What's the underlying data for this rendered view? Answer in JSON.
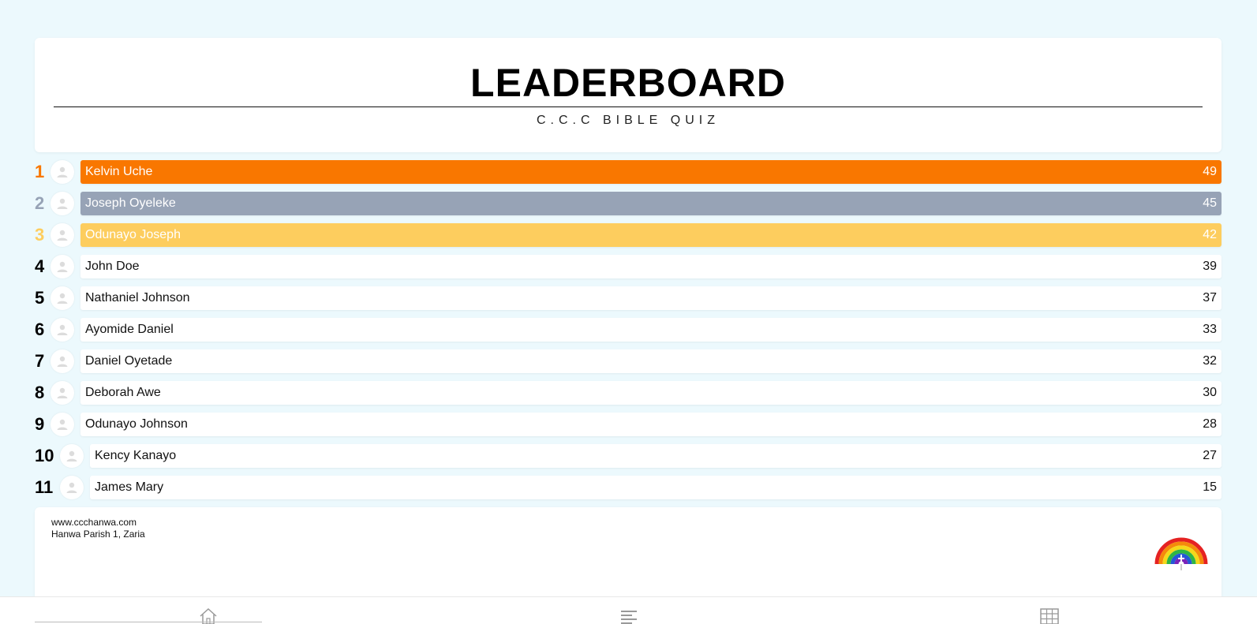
{
  "header": {
    "title": "LEADERBOARD",
    "subtitle": "C.C.C BIBLE QUIZ"
  },
  "colors": {
    "first": "#f97700",
    "second": "#97a3b6",
    "third": "#fdcd5e",
    "default_bar": "#ffffff",
    "page_background": "#ecf9fd"
  },
  "leaderboard": [
    {
      "rank": "1",
      "name": "Kelvin Uche",
      "score": "49"
    },
    {
      "rank": "2",
      "name": "Joseph Oyeleke",
      "score": "45"
    },
    {
      "rank": "3",
      "name": "Odunayo Joseph",
      "score": "42"
    },
    {
      "rank": "4",
      "name": "John Doe",
      "score": "39"
    },
    {
      "rank": "5",
      "name": "Nathaniel Johnson",
      "score": "37"
    },
    {
      "rank": "6",
      "name": "Ayomide Daniel",
      "score": "33"
    },
    {
      "rank": "7",
      "name": "Daniel Oyetade",
      "score": "32"
    },
    {
      "rank": "8",
      "name": "Deborah Awe",
      "score": "30"
    },
    {
      "rank": "9",
      "name": "Odunayo Johnson",
      "score": "28"
    },
    {
      "rank": "10",
      "name": "Kency Kanayo",
      "score": "27"
    },
    {
      "rank": "11",
      "name": "James Mary",
      "score": "15"
    }
  ],
  "footer": {
    "website": "www.ccchanwa.com",
    "address": "Hanwa Parish 1, Zaria",
    "logo_icon": "rainbow-church-logo"
  },
  "nav": {
    "items": [
      {
        "icon": "home-icon"
      },
      {
        "icon": "list-icon"
      },
      {
        "icon": "table-icon"
      }
    ]
  }
}
